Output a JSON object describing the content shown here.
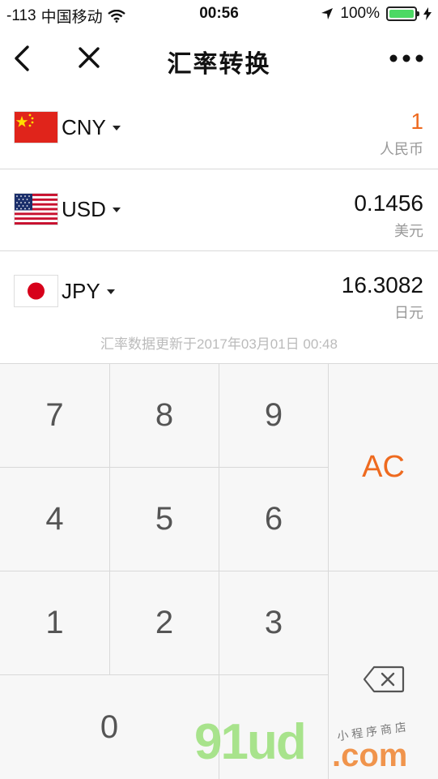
{
  "status_bar": {
    "signal": "-113",
    "carrier": "中国移动",
    "time": "00:56",
    "battery_text": "100%",
    "battery_level": 1.0,
    "battery_color": "#4cd964"
  },
  "nav": {
    "title": "汇率转换",
    "back_icon": "chevron-left-icon",
    "close_icon": "close-icon",
    "more_icon": "more-dots-icon"
  },
  "currencies": [
    {
      "code": "CNY",
      "amount": "1",
      "name": "人民币",
      "flag": "china-flag",
      "amount_color": "#ee6a1f"
    },
    {
      "code": "USD",
      "amount": "0.1456",
      "name": "美元",
      "flag": "usa-flag",
      "amount_color": "#111111"
    },
    {
      "code": "JPY",
      "amount": "16.3082",
      "name": "日元",
      "flag": "japan-flag",
      "amount_color": "#111111"
    }
  ],
  "update_note": "汇率数据更新于2017年03月01日 00:48",
  "keypad": {
    "keys": [
      "7",
      "8",
      "9",
      "4",
      "5",
      "6",
      "1",
      "2",
      "3",
      "0"
    ],
    "clear_label": "AC",
    "clear_color": "#ee6a1f",
    "backspace_icon": "backspace-icon"
  },
  "watermark": {
    "brand": "91ud",
    "domain": ".com",
    "tagline": "小程序商店"
  }
}
